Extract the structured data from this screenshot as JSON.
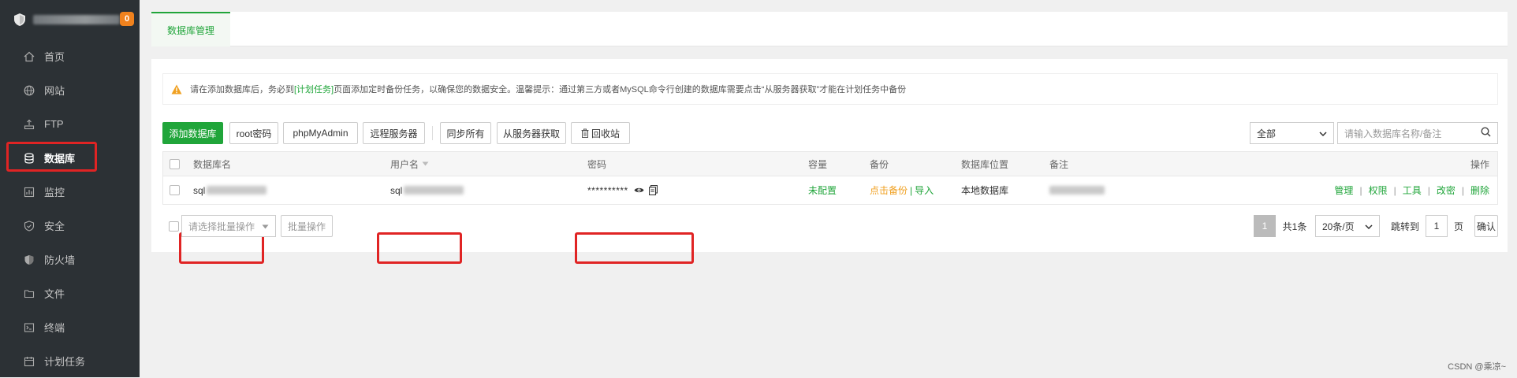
{
  "sidebar": {
    "badge": "0",
    "items": [
      {
        "label": "首页",
        "icon": "home-icon"
      },
      {
        "label": "网站",
        "icon": "globe-icon"
      },
      {
        "label": "FTP",
        "icon": "ftp-icon"
      },
      {
        "label": "数据库",
        "icon": "database-icon"
      },
      {
        "label": "监控",
        "icon": "monitor-icon"
      },
      {
        "label": "安全",
        "icon": "shield-icon"
      },
      {
        "label": "防火墙",
        "icon": "firewall-icon"
      },
      {
        "label": "文件",
        "icon": "folder-icon"
      },
      {
        "label": "终端",
        "icon": "terminal-icon"
      },
      {
        "label": "计划任务",
        "icon": "calendar-icon"
      }
    ],
    "active_index": 3
  },
  "tab": {
    "label": "数据库管理"
  },
  "warning": {
    "prefix": "请在添加数据库后，务必到",
    "link": "[计划任务]",
    "suffix": "页面添加定时备份任务，以确保您的数据安全。温馨提示：通过第三方或者MySQL命令行创建的数据库需要点击“从服务器获取”才能在计划任务中备份"
  },
  "toolbar": {
    "add_db": "添加数据库",
    "root_pwd": "root密码",
    "phpmyadmin": "phpMyAdmin",
    "remote": "远程服务器",
    "sync_all": "同步所有",
    "from_server": "从服务器获取",
    "recycle": "回收站",
    "filter_value": "全部",
    "search_placeholder": "请输入数据库名称/备注"
  },
  "table": {
    "headers": {
      "name": "数据库名",
      "user": "用户名",
      "password": "密码",
      "capacity": "容量",
      "backup": "备份",
      "location": "数据库位置",
      "note": "备注",
      "ops": "操作"
    },
    "rows": [
      {
        "name_prefix": "sql",
        "user_prefix": "sql",
        "password_mask": "**********",
        "capacity": "未配置",
        "backup_click": "点击备份",
        "backup_sep": "|",
        "backup_import": "导入",
        "location": "本地数据库",
        "ops": [
          "管理",
          "权限",
          "工具",
          "改密",
          "删除"
        ]
      }
    ]
  },
  "bottom": {
    "batch_placeholder": "请选择批量操作",
    "batch_btn": "批量操作",
    "page_current": "1",
    "total": "共1条",
    "per_page": "20条/页",
    "jump_label": "跳转到",
    "jump_value": "1",
    "page_unit": "页",
    "confirm": "确认"
  },
  "watermark": "CSDN @乘凉~",
  "colors": {
    "accent": "#20a53a",
    "sidebar": "#2c3135",
    "highlight": "#e02424",
    "badge": "#f0821e"
  }
}
